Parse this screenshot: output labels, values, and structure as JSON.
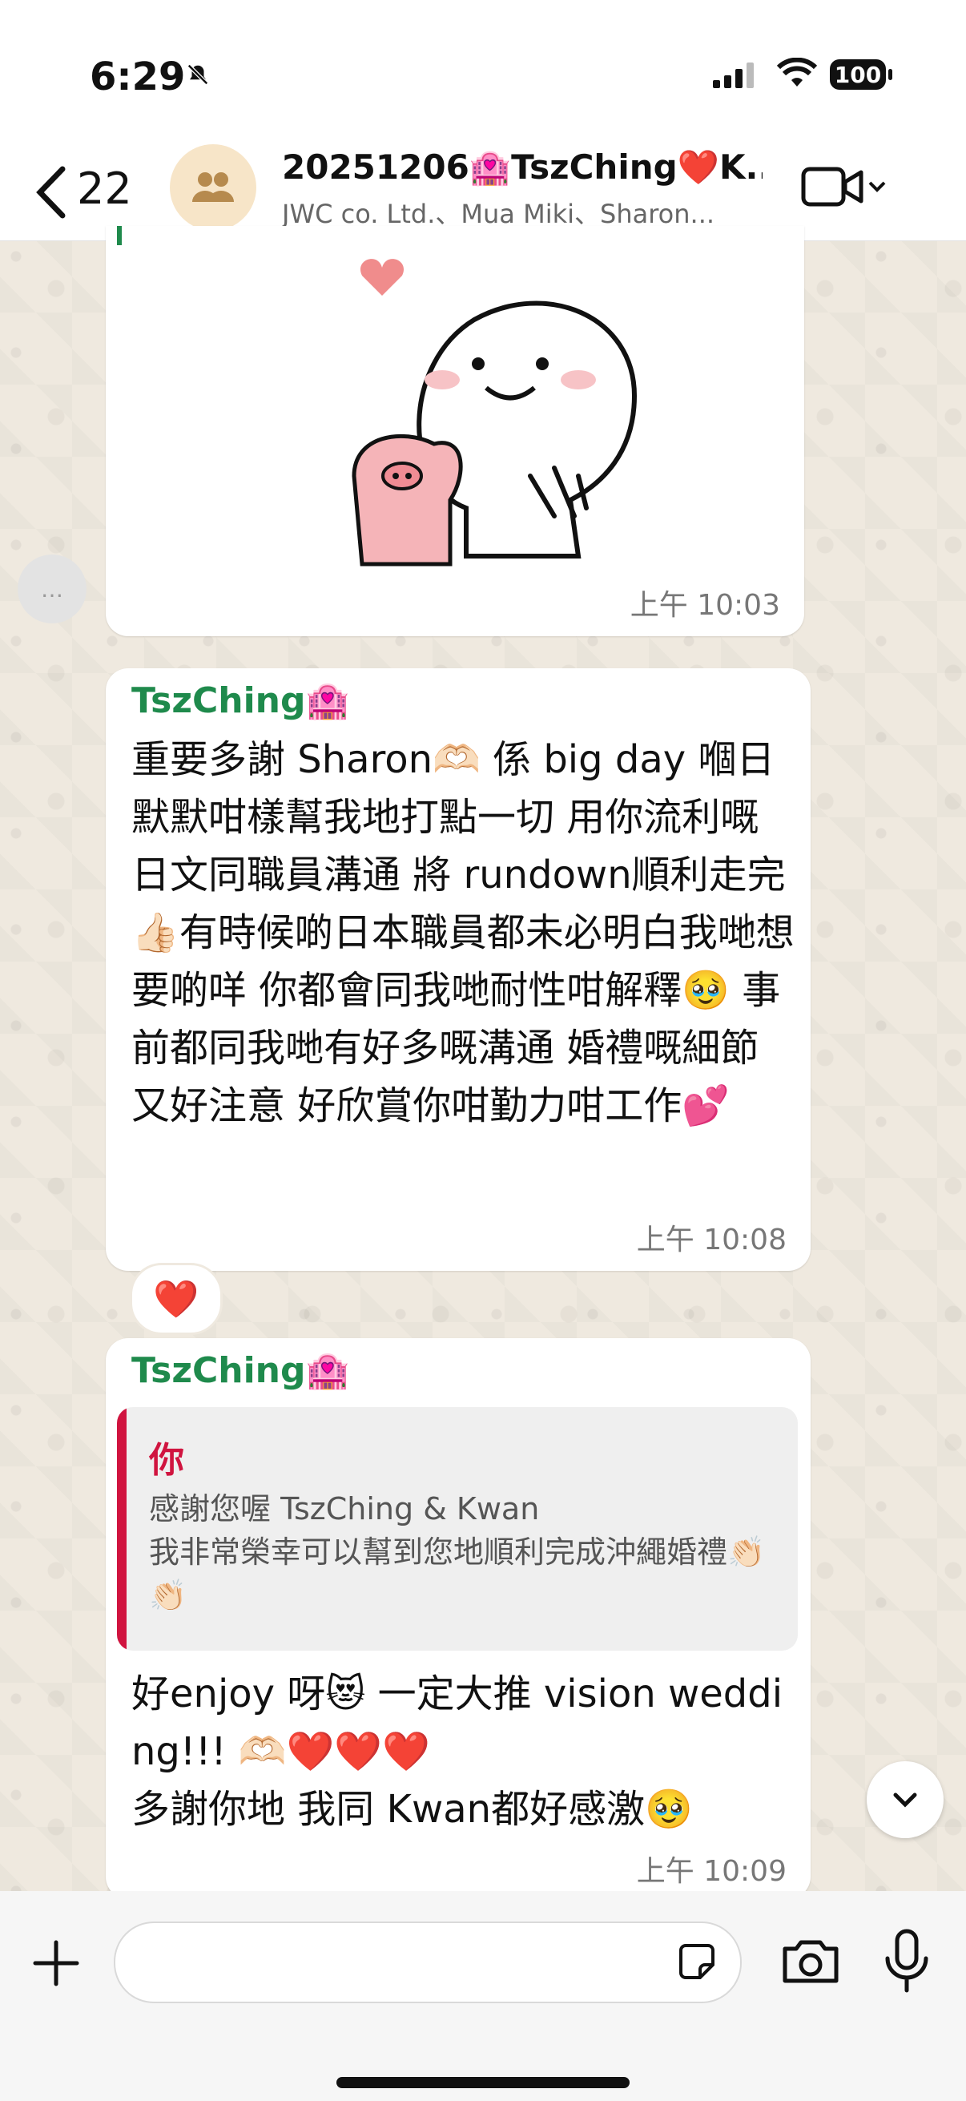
{
  "status_bar": {
    "time": "6:29",
    "battery": "100"
  },
  "header": {
    "back_count": "22",
    "title": "20251206🏩TszChing❤️K...",
    "subtitle": "JWC co. Ltd.、Mua Miki、Sharon..."
  },
  "messages": [
    {
      "type": "sticker",
      "time": "上午 10:03"
    },
    {
      "sender": "TszChing🏩",
      "text": "重要多謝 Sharon🫶🏻 係 big day 嗰日默默咁樣幫我地打點一切 用你流利嘅日文同職員溝通 將 rundown順利走完👍🏻有時候啲日本職員都未必明白我哋想要啲咩 你都會同我哋耐性咁解釋🥹 事前都同我哋有好多嘅溝通 婚禮嘅細節又好注意 好欣賞你咁勤力咁工作💕",
      "time": "上午 10:08",
      "reaction": "❤️"
    },
    {
      "sender": "TszChing🏩",
      "quote": {
        "name": "你",
        "text": "感謝您喔 TszChing & Kwan\n我非常榮幸可以幫到您地順利完成沖繩婚禮👏🏻👏🏻"
      },
      "text": "好enjoy 呀😻 一定大推 vision wedding!!! 🫶🏻❤️❤️❤️\n多謝你地 我同 Kwan都好感激🥹",
      "time": "上午 10:09"
    }
  ],
  "composer": {
    "placeholder": ""
  },
  "icons": [
    "bell-off-icon",
    "signal-icon",
    "wifi-icon",
    "back-chevron-icon",
    "group-icon",
    "video-camera-icon",
    "chevron-down-icon",
    "plus-icon",
    "sticker-icon",
    "camera-icon",
    "microphone-icon"
  ],
  "colors": {
    "sender": "#1f8a4c",
    "quote_accent": "#d0143f",
    "background": "#efe9df"
  }
}
